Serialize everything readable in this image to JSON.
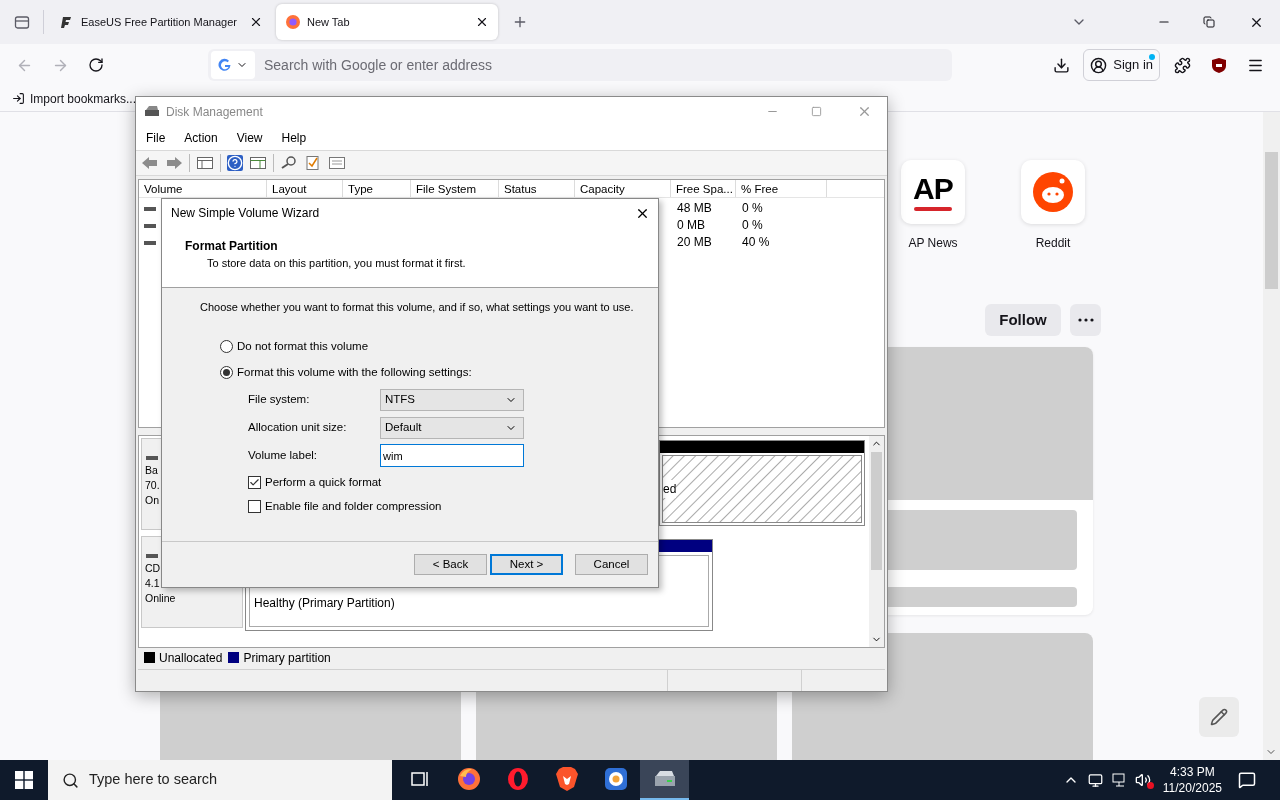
{
  "browser": {
    "tabs": [
      {
        "title": "EaseUS Free Partition Manager",
        "selected": false
      },
      {
        "title": "New Tab",
        "selected": true
      }
    ],
    "address_bar": {
      "placeholder": "Search with Google or enter address"
    },
    "sign_in": "Sign in",
    "bookmarks": [
      "Import bookmarks..."
    ],
    "shortcuts": [
      {
        "label": "AP News",
        "kind": "ap",
        "logo_text": "AP"
      },
      {
        "label": "Reddit",
        "kind": "reddit"
      }
    ],
    "follow_button": "Follow"
  },
  "disk_management": {
    "title": "Disk Management",
    "menu": [
      "File",
      "Action",
      "View",
      "Help"
    ],
    "columns": [
      "Volume",
      "Layout",
      "Type",
      "File System",
      "Status",
      "Capacity",
      "Free Spa...",
      "% Free"
    ],
    "rows": [
      {
        "free_space": "48 MB",
        "percent_free": "0 %"
      },
      {
        "free_space": "0 MB",
        "percent_free": "0 %"
      },
      {
        "free_space": "20 MB",
        "percent_free": "40 %"
      }
    ],
    "disks": [
      {
        "lines": [
          "Ba",
          "70.",
          "On"
        ],
        "partition_text": "ed",
        "kind": "unallocated"
      },
      {
        "lines": [
          "CD",
          "4.1",
          "Online"
        ],
        "partition_text": "Healthy (Primary Partition)",
        "kind": "primary"
      }
    ],
    "legend": [
      {
        "label": "Unallocated",
        "color": "#000000"
      },
      {
        "label": "Primary partition",
        "color": "#000080"
      }
    ]
  },
  "wizard": {
    "title": "New Simple Volume Wizard",
    "heading": "Format Partition",
    "subheading": "To store data on this partition, you must format it first.",
    "instruction": "Choose whether you want to format this volume, and if so, what settings you want to use.",
    "options": [
      {
        "label": "Do not format this volume",
        "selected": false
      },
      {
        "label": "Format this volume with the following settings:",
        "selected": true
      }
    ],
    "fields": [
      {
        "label": "File system:",
        "kind": "select",
        "value": "NTFS"
      },
      {
        "label": "Allocation unit size:",
        "kind": "select",
        "value": "Default"
      },
      {
        "label": "Volume label:",
        "kind": "text",
        "value": "wim"
      }
    ],
    "checkboxes": [
      {
        "label": "Perform a quick format",
        "checked": true
      },
      {
        "label": "Enable file and folder compression",
        "checked": false
      }
    ],
    "buttons": [
      {
        "label": "< Back",
        "focused": false
      },
      {
        "label": "Next >",
        "focused": true
      },
      {
        "label": "Cancel",
        "focused": false
      }
    ]
  },
  "taskbar": {
    "search_placeholder": "Type here to search",
    "apps": [
      {
        "kind": "taskview",
        "active": false
      },
      {
        "kind": "firefox",
        "active": false
      },
      {
        "kind": "opera",
        "active": false
      },
      {
        "kind": "brave",
        "active": false
      },
      {
        "kind": "blue",
        "active": false
      },
      {
        "kind": "disk",
        "active": true
      }
    ],
    "time": "4:33 PM",
    "date": "11/20/2025"
  }
}
